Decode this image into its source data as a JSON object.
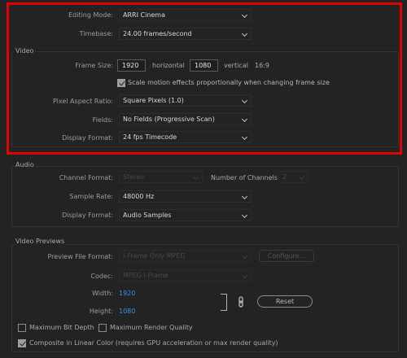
{
  "editing_mode": {
    "label": "Editing Mode:",
    "value": "ARRI Cinema"
  },
  "timebase": {
    "label": "Timebase:",
    "value": "24.00  frames/second"
  },
  "video": {
    "title": "Video",
    "frame_size_label": "Frame Size:",
    "width": "1920",
    "horizontal_label": "horizontal",
    "height": "1080",
    "vertical_label": "vertical",
    "aspect": "16:9",
    "scale_label": "Scale motion effects proportionally when changing frame size",
    "scale_checked": true,
    "par_label": "Pixel Aspect Ratio:",
    "par_value": "Square Pixels (1.0)",
    "fields_label": "Fields:",
    "fields_value": "No Fields (Progressive Scan)",
    "display_format_label": "Display Format:",
    "display_format_value": "24 fps Timecode"
  },
  "audio": {
    "title": "Audio",
    "channel_format_label": "Channel Format:",
    "channel_format_value": "Stereo",
    "num_channels_label": "Number of Channels:",
    "num_channels_value": "2",
    "sample_rate_label": "Sample Rate:",
    "sample_rate_value": "48000 Hz",
    "display_format_label": "Display Format:",
    "display_format_value": "Audio Samples"
  },
  "previews": {
    "title": "Video Previews",
    "file_format_label": "Preview File Format:",
    "file_format_value": "I-Frame Only MPEG",
    "configure_label": "Configure...",
    "codec_label": "Codec:",
    "codec_value": "MPEG I-Frame",
    "width_label": "Width:",
    "width_value": "1920",
    "height_label": "Height:",
    "height_value": "1080",
    "reset_label": "Reset"
  },
  "options": {
    "max_bit_depth": "Maximum Bit Depth",
    "max_render_quality": "Maximum Render Quality",
    "linear_color": "Composite in Linear Color (requires GPU acceleration or max render quality)"
  },
  "colors": {
    "highlight": "#e00000",
    "link": "#3a8ee6"
  }
}
